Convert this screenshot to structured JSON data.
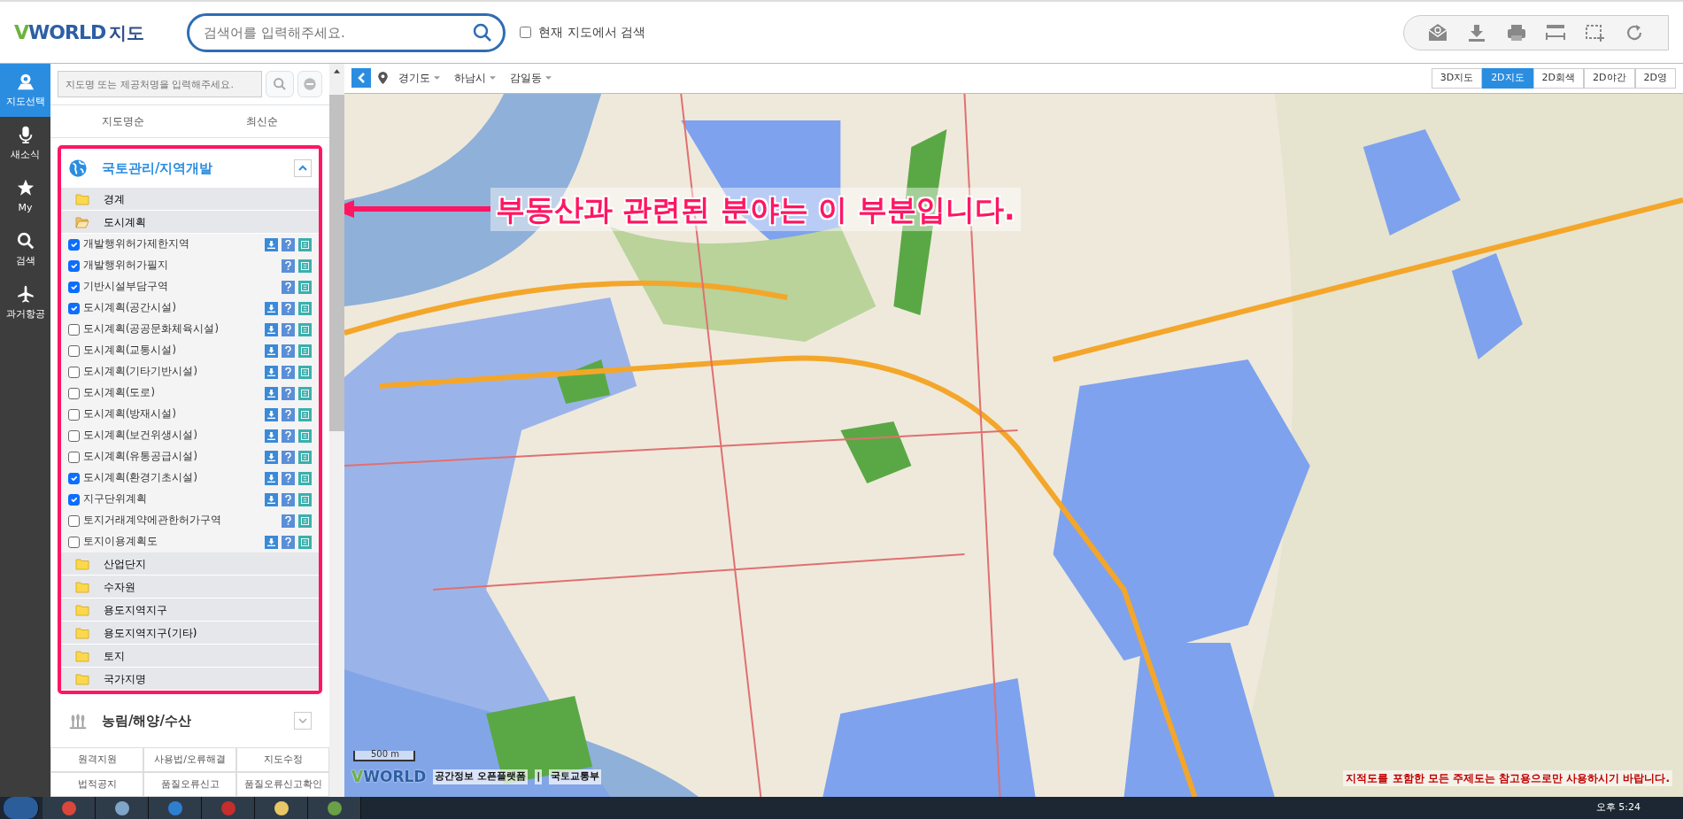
{
  "header": {
    "logo": {
      "text": "VWORLD",
      "suffix": "지도"
    },
    "search": {
      "placeholder": "검색어를 입력해주세요."
    },
    "scope_checkbox": {
      "label": "현재 지도에서 검색",
      "checked": false
    }
  },
  "nav_rail": [
    {
      "label": "지도선택",
      "selected": true
    },
    {
      "label": "새소식",
      "selected": false
    },
    {
      "label": "My",
      "selected": false
    },
    {
      "label": "검색",
      "selected": false
    },
    {
      "label": "과거항공",
      "selected": false
    }
  ],
  "sidebar": {
    "search": {
      "placeholder": "지도명 또는 제공처명을 입력해주세요."
    },
    "sort_tabs": [
      {
        "label": "지도명순",
        "selected": false
      },
      {
        "label": "최신순",
        "selected": false
      }
    ],
    "categories": [
      {
        "title": "국토관리/지역개발",
        "expanded": true,
        "highlighted": true,
        "folders": [
          {
            "label": "경계",
            "expanded": false
          },
          {
            "label": "도시계획",
            "expanded": true,
            "layers": [
              {
                "label": "개발행위허가제한지역",
                "checked": true,
                "download": true
              },
              {
                "label": "개발행위허가필지",
                "checked": true,
                "download": false
              },
              {
                "label": "기반시설부담구역",
                "checked": true,
                "download": false
              },
              {
                "label": "도시계획(공간시설)",
                "checked": true,
                "download": true
              },
              {
                "label": "도시계획(공공문화체육시설)",
                "checked": false,
                "download": true
              },
              {
                "label": "도시계획(교통시설)",
                "checked": false,
                "download": true
              },
              {
                "label": "도시계획(기타기반시설)",
                "checked": false,
                "download": true
              },
              {
                "label": "도시계획(도로)",
                "checked": false,
                "download": true
              },
              {
                "label": "도시계획(방재시설)",
                "checked": false,
                "download": true
              },
              {
                "label": "도시계획(보건위생시설)",
                "checked": false,
                "download": true
              },
              {
                "label": "도시계획(유통공급시설)",
                "checked": false,
                "download": true
              },
              {
                "label": "도시계획(환경기초시설)",
                "checked": true,
                "download": true
              },
              {
                "label": "지구단위계획",
                "checked": true,
                "download": true
              },
              {
                "label": "토지거래계약에관한허가구역",
                "checked": false,
                "download": false
              },
              {
                "label": "토지이용계획도",
                "checked": false,
                "download": true
              }
            ]
          },
          {
            "label": "산업단지",
            "expanded": false
          },
          {
            "label": "수자원",
            "expanded": false
          },
          {
            "label": "용도지역지구",
            "expanded": false
          },
          {
            "label": "용도지역지구(기타)",
            "expanded": false
          },
          {
            "label": "토지",
            "expanded": false
          },
          {
            "label": "국가지명",
            "expanded": false
          }
        ]
      },
      {
        "title": "농림/해양/수산",
        "expanded": false,
        "highlighted": false
      }
    ],
    "footer_links": [
      "원격지원",
      "사용법/오류해결",
      "지도수정",
      "법적공지",
      "품질오류신고",
      "품질오류신고확인"
    ]
  },
  "map": {
    "breadcrumb": [
      "경기도",
      "하남시",
      "감일동"
    ],
    "map_types": [
      {
        "label": "3D지도",
        "selected": false
      },
      {
        "label": "2D지도",
        "selected": true
      },
      {
        "label": "2D회색",
        "selected": false
      },
      {
        "label": "2D야간",
        "selected": false
      },
      {
        "label": "2D영",
        "selected": false
      }
    ],
    "scale": "500 m",
    "logo": "VWORLD",
    "platform": "공간정보 오픈플랫폼",
    "separator": "|",
    "ministry": "국토교통부",
    "notice": "지적도를 포함한 모든 주제도는 참고용으로만 사용하시기 바랍니다."
  },
  "annotation": {
    "text": "부동산과 관련된 분야는 이 부분입니다."
  },
  "taskbar": {
    "clock": "오후 5:24"
  }
}
